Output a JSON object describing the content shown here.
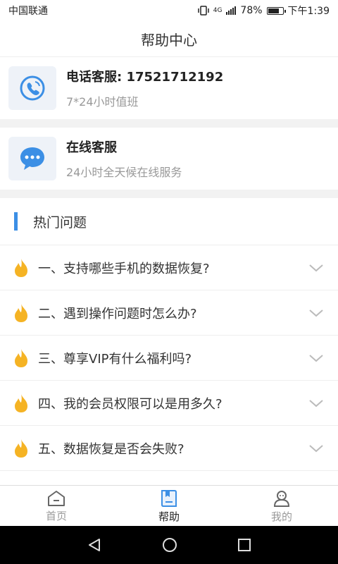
{
  "status": {
    "carrier": "中国联通",
    "net": "4G",
    "battery": "78%",
    "time": "下午1:39"
  },
  "header": {
    "title": "帮助中心"
  },
  "phone_service": {
    "title": "电话客服: 17521712192",
    "subtitle": "7*24小时值班"
  },
  "online_service": {
    "title": "在线客服",
    "subtitle": "24小时全天候在线服务"
  },
  "hot": {
    "title": "热门问题",
    "questions": [
      "一、支持哪些手机的数据恢复?",
      "二、遇到操作问题时怎么办?",
      "三、尊享VIP有什么福利吗?",
      "四、我的会员权限可以是用多久?",
      "五、数据恢复是否会失败?"
    ]
  },
  "tabs": [
    {
      "label": "首页",
      "icon": "home-icon"
    },
    {
      "label": "帮助",
      "icon": "help-book-icon"
    },
    {
      "label": "我的",
      "icon": "profile-icon"
    }
  ],
  "colors": {
    "accent": "#3c8fe5",
    "flame": "#f5b324"
  }
}
